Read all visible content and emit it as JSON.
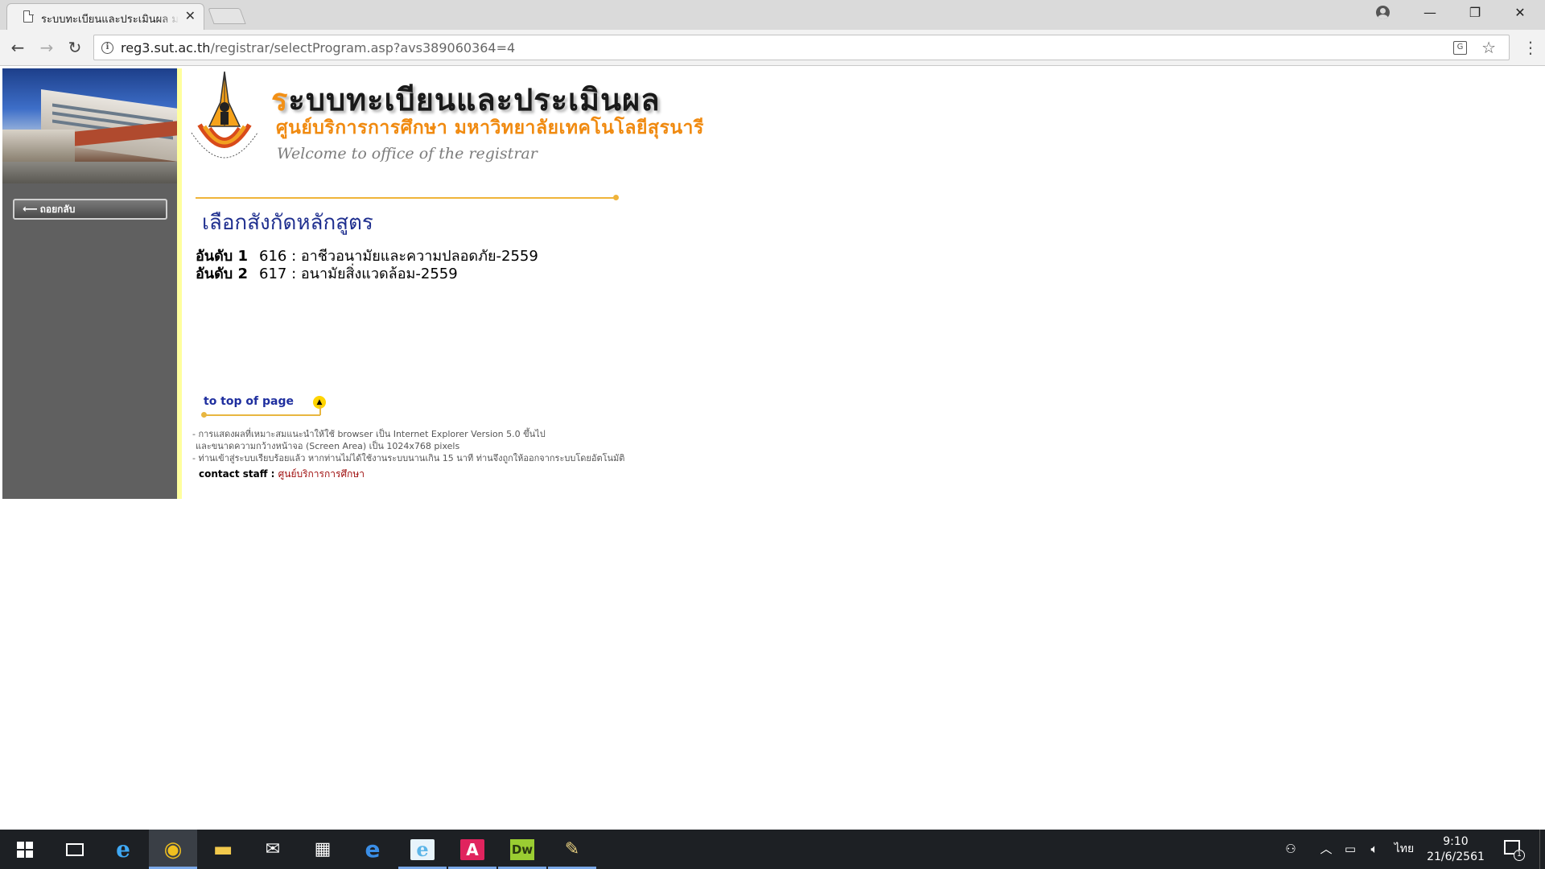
{
  "browser": {
    "tab_title": "ระบบทะเบียนและประเมินผล มหาวิทยาลัยเทคโนโลยีสุรนารี",
    "url_host": "reg3.sut.ac.th",
    "url_path": "/registrar/selectProgram.asp?avs389060364=4",
    "window_controls": {
      "minimize": "—",
      "restore": "❐",
      "close": "✕"
    },
    "nav_icons": {
      "back": "back-arrow-icon",
      "forward": "forward-arrow-icon",
      "reload": "reload-icon"
    }
  },
  "header": {
    "title_first_letter": "ร",
    "title_rest": "ะบบทะเบียนและประเมินผล",
    "subtitle": "ศูนย์บริการการศึกษา มหาวิทยาลัยเทคโนโลยีสุรนารี",
    "welcome": "Welcome to office of the registrar"
  },
  "sidebar": {
    "back_label": "ถอยกลับ"
  },
  "main": {
    "heading": "เลือกสังกัดหลักสูตร",
    "programs": [
      {
        "rank": "อันดับ 1",
        "program": "616 : อาชีวอนามัยและความปลอดภัย-2559"
      },
      {
        "rank": "อันดับ 2",
        "program": "617 : อนามัยสิ่งแวดล้อม-2559"
      }
    ],
    "top_link": "to top of page",
    "notes": [
      "- การแสดงผลที่เหมาะสมแนะนำให้ใช้ browser เป็น Internet Explorer Version 5.0 ขึ้นไป",
      "  และขนาดความกว้างหน้าจอ (Screen Area) เป็น 1024x768 pixels",
      "- ท่านเข้าสู่ระบบเรียบร้อยแล้ว หากท่านไม่ได้ใช้งานระบบนานเกิน 15 นาที ท่านจึงถูกให้ออกจากระบบโดยอัตโนมัติ"
    ],
    "contact_label": "contact staff : ",
    "contact_link": "ศูนย์บริการการศึกษา"
  },
  "taskbar": {
    "apps": [
      {
        "name": "internet-explorer",
        "glyph": "e",
        "color": "#3fa9f5"
      },
      {
        "name": "chrome",
        "glyph": "◉",
        "color": "#f0c020"
      },
      {
        "name": "file-explorer",
        "glyph": "▬",
        "color": "#f2c94c"
      },
      {
        "name": "mail",
        "glyph": "✉",
        "color": "#ffffff"
      },
      {
        "name": "store",
        "glyph": "▦",
        "color": "#ffffff"
      },
      {
        "name": "edge",
        "glyph": "e",
        "color": "#3a8ee6"
      },
      {
        "name": "ie-document",
        "glyph": "e",
        "color": "#5bb5e8"
      },
      {
        "name": "acrobat",
        "glyph": "A",
        "color": "#e0245e"
      },
      {
        "name": "dreamweaver",
        "glyph": "Dw",
        "color": "#9acd32"
      },
      {
        "name": "paint",
        "glyph": "✎",
        "color": "#e8d080"
      }
    ],
    "language": "ไทย",
    "time": "9:10",
    "date": "21/6/2561",
    "notification_count": "1"
  }
}
